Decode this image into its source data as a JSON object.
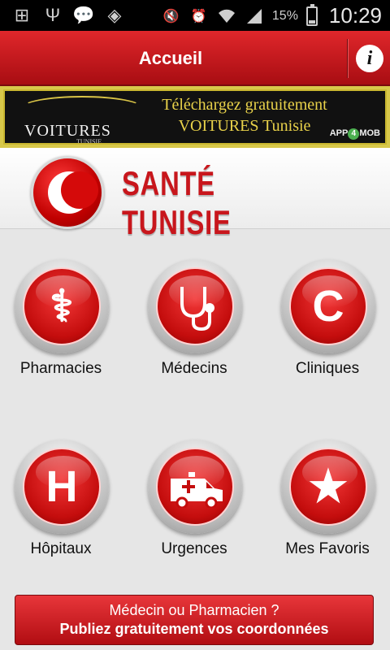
{
  "status_bar": {
    "left_icons": [
      "add-notification-icon",
      "usb-icon",
      "messenger-icon",
      "checklist-icon"
    ],
    "right_icons": [
      "mute-icon",
      "alarm-icon",
      "wifi-icon",
      "signal-icon"
    ],
    "battery_percent": "15%",
    "time": "10:29"
  },
  "header": {
    "title": "Accueil",
    "info_label": "i"
  },
  "ad_banner": {
    "brand": "VOITURES",
    "brand_sub": "TUNISIE",
    "line1": "Téléchargez gratuitement",
    "line2": "VOITURES Tunisie",
    "tag_app": "APP",
    "tag_four": "4",
    "tag_mob": "MOB"
  },
  "logo": {
    "title": "SANTÉ TUNISIE"
  },
  "tiles": [
    {
      "label": "Pharmacies",
      "icon": "caduceus-icon",
      "glyph": "⚕"
    },
    {
      "label": "Médecins",
      "icon": "stethoscope-icon",
      "glyph": "∿"
    },
    {
      "label": "Cliniques",
      "icon": "letter-c-icon",
      "glyph": "C"
    },
    {
      "label": "Hôpitaux",
      "icon": "letter-h-icon",
      "glyph": "H"
    },
    {
      "label": "Urgences",
      "icon": "ambulance-icon",
      "glyph": "🚑"
    },
    {
      "label": "Mes Favoris",
      "icon": "star-icon",
      "glyph": "★"
    }
  ],
  "cta": {
    "line1": "Médecin ou Pharmacien ?",
    "line2": "Publiez gratuitement vos coordonnées"
  },
  "colors": {
    "accent": "#c8161c",
    "header": "#d61f24",
    "ad_gold": "#e9d24a"
  }
}
